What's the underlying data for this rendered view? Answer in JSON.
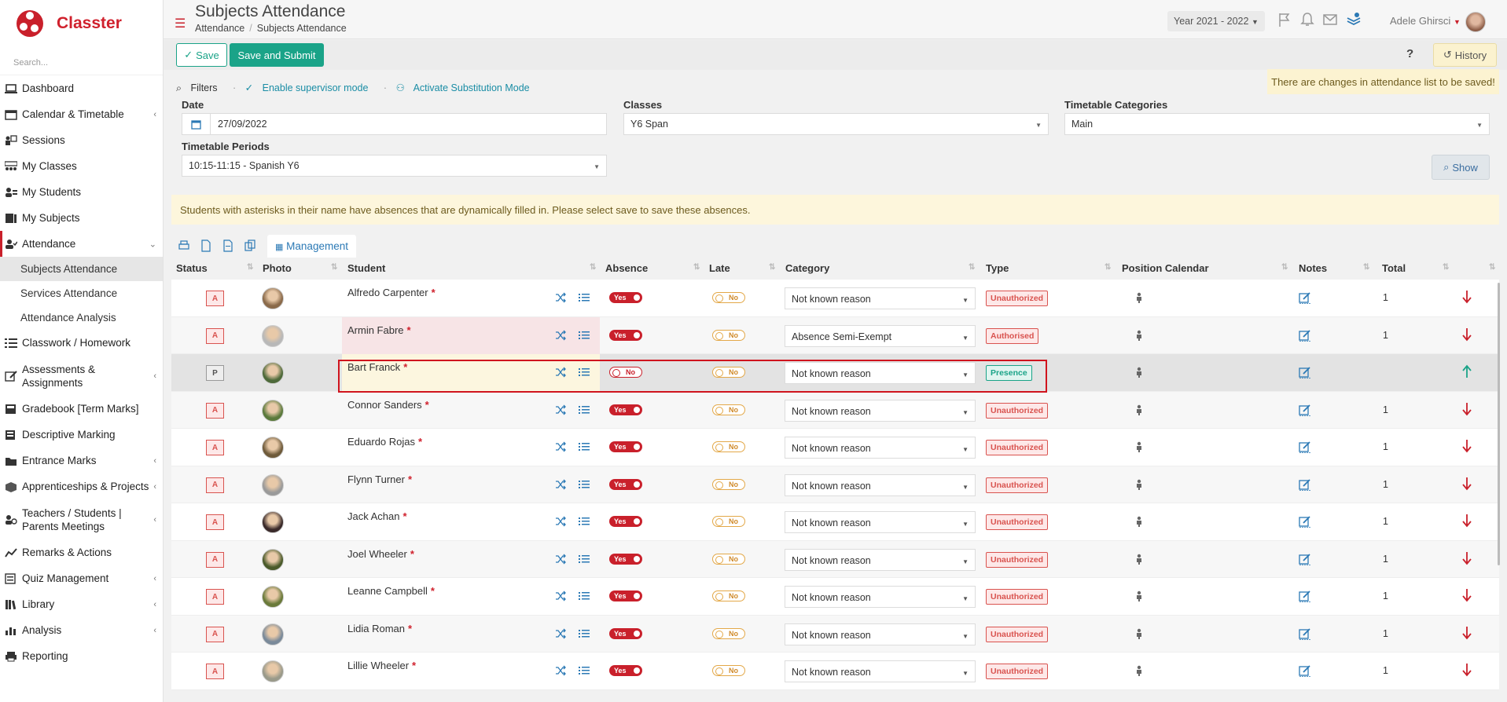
{
  "app": {
    "name": "Classter",
    "search_placeholder": "Search...",
    "brand_color": "#c9202b",
    "accent_color": "#1aa388"
  },
  "sidebar": {
    "items": [
      {
        "label": "Dashboard",
        "icon": "laptop-icon"
      },
      {
        "label": "Calendar & Timetable",
        "icon": "calendar-icon"
      },
      {
        "label": "Sessions",
        "icon": "presentation-icon"
      },
      {
        "label": "My Classes",
        "icon": "classes-icon"
      },
      {
        "label": "My Students",
        "icon": "students-icon"
      },
      {
        "label": "My Subjects",
        "icon": "book-icon"
      },
      {
        "label": "Attendance",
        "icon": "attendance-icon"
      },
      {
        "label": "Classwork / Homework",
        "icon": "list-icon"
      },
      {
        "label": "Assessments & Assignments",
        "icon": "edit-icon"
      },
      {
        "label": "Gradebook [Term Marks]",
        "icon": "gradebook-icon"
      },
      {
        "label": "Descriptive Marking",
        "icon": "marking-icon"
      },
      {
        "label": "Entrance Marks",
        "icon": "folder-icon"
      },
      {
        "label": "Apprenticeships & Projects",
        "icon": "box-icon"
      },
      {
        "label": "Teachers / Students | Parents Meetings",
        "icon": "meeting-icon"
      },
      {
        "label": "Remarks & Actions",
        "icon": "chart-line-icon"
      },
      {
        "label": "Quiz Management",
        "icon": "quiz-icon"
      },
      {
        "label": "Library",
        "icon": "library-icon"
      },
      {
        "label": "Analysis",
        "icon": "bar-chart-icon"
      },
      {
        "label": "Reporting",
        "icon": "printer-icon"
      }
    ],
    "attendance_sub": [
      "Subjects Attendance",
      "Services Attendance",
      "Attendance Analysis"
    ]
  },
  "header": {
    "title": "Subjects Attendance",
    "breadcrumb": [
      "Attendance",
      "Subjects Attendance"
    ],
    "year": "Year 2021 - 2022",
    "user": "Adele Ghirsci"
  },
  "toolbar": {
    "save": "Save",
    "save_submit": "Save and Submit",
    "help": "?",
    "history": "History",
    "changes_note": "There are changes in attendance list to be saved!"
  },
  "filters": {
    "filters_label": "Filters",
    "supervisor": "Enable supervisor mode",
    "substitution": "Activate Substitution Mode",
    "date_label": "Date",
    "date_value": "27/09/2022",
    "classes_label": "Classes",
    "classes_value": "Y6 Span",
    "timetable_categories_label": "Timetable Categories",
    "timetable_categories_value": "Main",
    "timetable_periods_label": "Timetable Periods",
    "timetable_periods_value": "10:15-11:15 - Spanish Y6",
    "show": "Show"
  },
  "notice": "Students with asterisks in their name have absences that are dynamically filled in. Please select save to save these absences.",
  "table_tools": {
    "management": "Management"
  },
  "table": {
    "columns": [
      "Status",
      "Photo",
      "Student",
      "Absence",
      "Late",
      "Category",
      "Type",
      "Position Calendar",
      "Notes",
      "Total"
    ],
    "rows": [
      {
        "status": "A",
        "name": "Alfredo Carpenter",
        "absence": "Yes",
        "late": "No",
        "category": "Not known reason",
        "type": "Unauthorized",
        "total": "1"
      },
      {
        "status": "A",
        "name": "Armin Fabre",
        "absence": "Yes",
        "late": "No",
        "category": "Absence Semi-Exempt",
        "type": "Authorised",
        "total": "1"
      },
      {
        "status": "P",
        "name": "Bart Franck",
        "absence": "No",
        "late": "No",
        "category": "Not known reason",
        "type": "Presence",
        "total": ""
      },
      {
        "status": "A",
        "name": "Connor Sanders",
        "absence": "Yes",
        "late": "No",
        "category": "Not known reason",
        "type": "Unauthorized",
        "total": "1"
      },
      {
        "status": "A",
        "name": "Eduardo Rojas",
        "absence": "Yes",
        "late": "No",
        "category": "Not known reason",
        "type": "Unauthorized",
        "total": "1"
      },
      {
        "status": "A",
        "name": "Flynn Turner",
        "absence": "Yes",
        "late": "No",
        "category": "Not known reason",
        "type": "Unauthorized",
        "total": "1"
      },
      {
        "status": "A",
        "name": "Jack Achan",
        "absence": "Yes",
        "late": "No",
        "category": "Not known reason",
        "type": "Unauthorized",
        "total": "1"
      },
      {
        "status": "A",
        "name": "Joel Wheeler",
        "absence": "Yes",
        "late": "No",
        "category": "Not known reason",
        "type": "Unauthorized",
        "total": "1"
      },
      {
        "status": "A",
        "name": "Leanne Campbell",
        "absence": "Yes",
        "late": "No",
        "category": "Not known reason",
        "type": "Unauthorized",
        "total": "1"
      },
      {
        "status": "A",
        "name": "Lidia Roman",
        "absence": "Yes",
        "late": "No",
        "category": "Not known reason",
        "type": "Unauthorized",
        "total": "1"
      },
      {
        "status": "A",
        "name": "Lillie Wheeler",
        "absence": "Yes",
        "late": "No",
        "category": "Not known reason",
        "type": "Unauthorized",
        "total": "1"
      }
    ]
  }
}
